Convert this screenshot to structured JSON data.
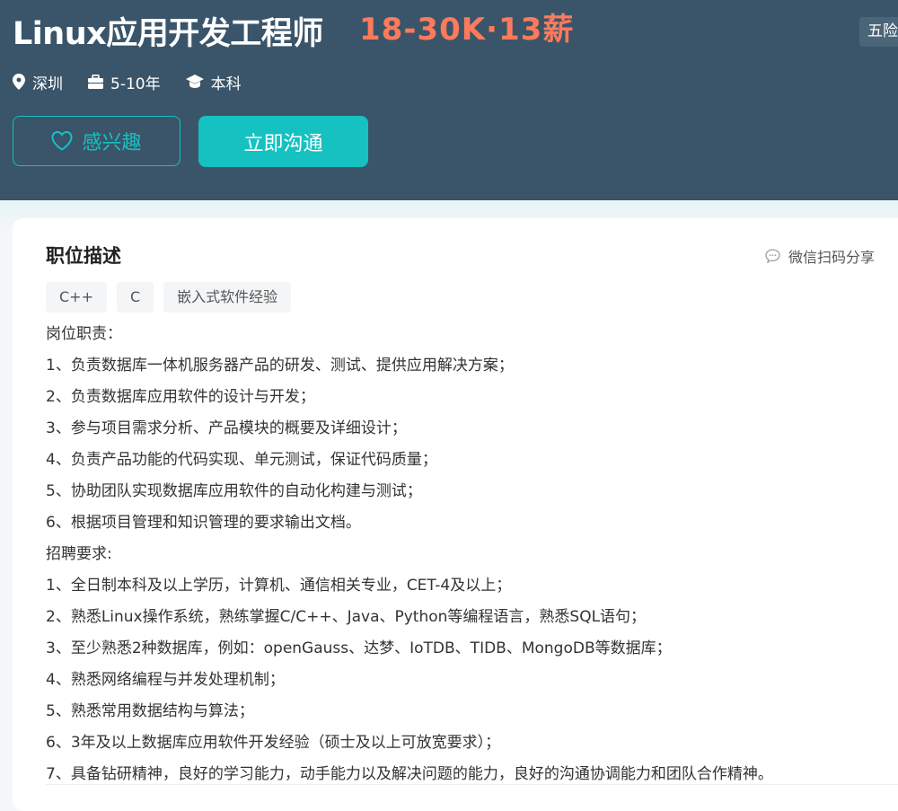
{
  "job": {
    "title": "Linux应用开发工程师",
    "salary": "18-30K·13薪",
    "benefit_badge": "五险",
    "location": "深圳",
    "experience": "5-10年",
    "education": "本科"
  },
  "actions": {
    "interest_label": "感兴趣",
    "chat_label": "立即沟通"
  },
  "description": {
    "title": "职位描述",
    "share_label": "微信扫码分享",
    "tags": [
      "C++",
      "C",
      "嵌入式软件经验"
    ],
    "lines": [
      "岗位职责：",
      "1、负责数据库一体机服务器产品的研发、测试、提供应用解决方案；",
      "2、负责数据库应用软件的设计与开发；",
      "3、参与项目需求分析、产品模块的概要及详细设计；",
      "4、负责产品功能的代码实现、单元测试，保证代码质量；",
      "5、协助团队实现数据库应用软件的自动化构建与测试；",
      "6、根据项目管理和知识管理的要求输出文档。",
      "招聘要求:",
      "1、全日制本科及以上学历，计算机、通信相关专业，CET-4及以上；",
      "2、熟悉Linux操作系统，熟练掌握C/C++、Java、Python等编程语言，熟悉SQL语句；",
      "3、至少熟悉2种数据库，例如：openGauss、达梦、IoTDB、TIDB、MongoDB等数据库；",
      "4、熟悉网络编程与并发处理机制；",
      "5、熟悉常用数据结构与算法；",
      "6、3年及以上数据库应用软件开发经验（硕士及以上可放宽要求）；",
      "7、具备钻研精神，良好的学习能力，动手能力以及解决问题的能力，良好的沟通协调能力和团队合作精神。"
    ]
  },
  "colors": {
    "header_bg": "#3a5569",
    "accent": "#16c1c2",
    "salary": "#fe7a5c"
  },
  "icons": {
    "location": "location-pin-icon",
    "experience": "briefcase-icon",
    "education": "graduation-cap-icon",
    "interest": "heart-icon",
    "share": "chat-bubble-icon"
  }
}
